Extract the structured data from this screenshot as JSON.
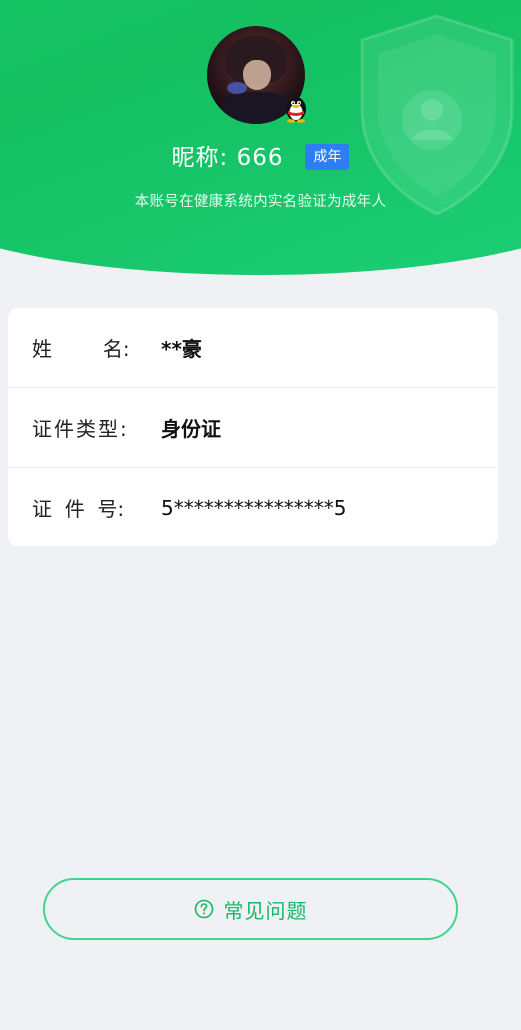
{
  "profile": {
    "nickname": "昵称:  666",
    "adult_badge": "成年",
    "verification_note": "本账号在健康系统内实名验证为成年人"
  },
  "info": {
    "name_label": "姓        名:",
    "name_value": "**豪",
    "id_type_label": "证件类型:",
    "id_type_value": "身份证",
    "id_number_label": "证  件  号:",
    "id_number_value": "5****************5"
  },
  "faq": {
    "label": "常见问题",
    "icon": "question-circle-icon"
  },
  "colors": {
    "brand_green": "#19c76a",
    "badge_blue": "#2f7df6",
    "faq_green": "#16b865",
    "background": "#f0f1f5"
  }
}
